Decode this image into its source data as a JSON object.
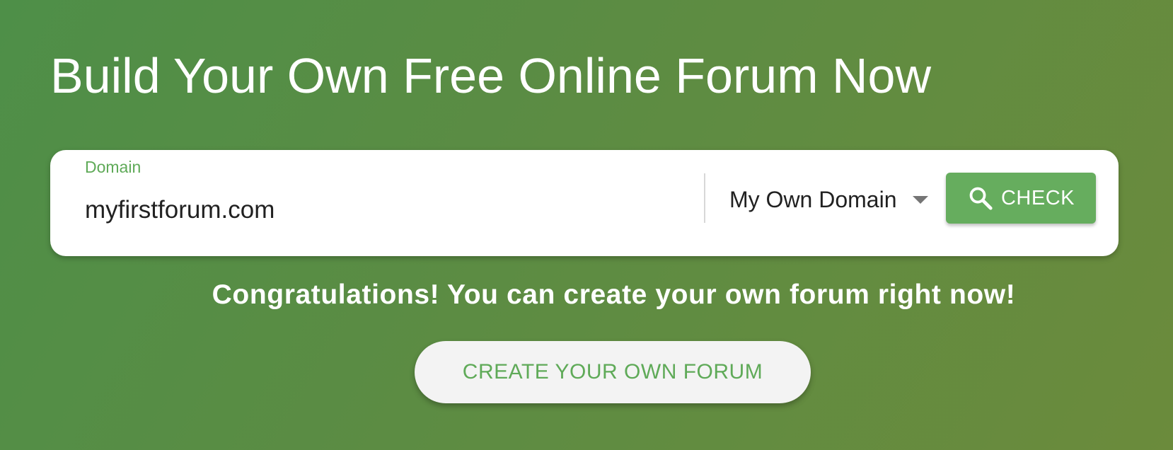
{
  "hero": {
    "title": "Build Your Own Free Online Forum Now"
  },
  "search": {
    "label": "Domain",
    "value": "myfirstforum.com",
    "domain_type": "My Own Domain",
    "check_label": "CHECK"
  },
  "result": {
    "message": "Congratulations! You can create your own forum right now!"
  },
  "cta": {
    "label": "CREATE YOUR OWN FORUM"
  },
  "colors": {
    "accent_green": "#66ad5e",
    "label_green": "#5faa58",
    "background_start": "#4e8f48",
    "background_end": "#6b8b3c"
  },
  "icons": {
    "check_button": "search-icon",
    "select": "caret-down-icon"
  }
}
